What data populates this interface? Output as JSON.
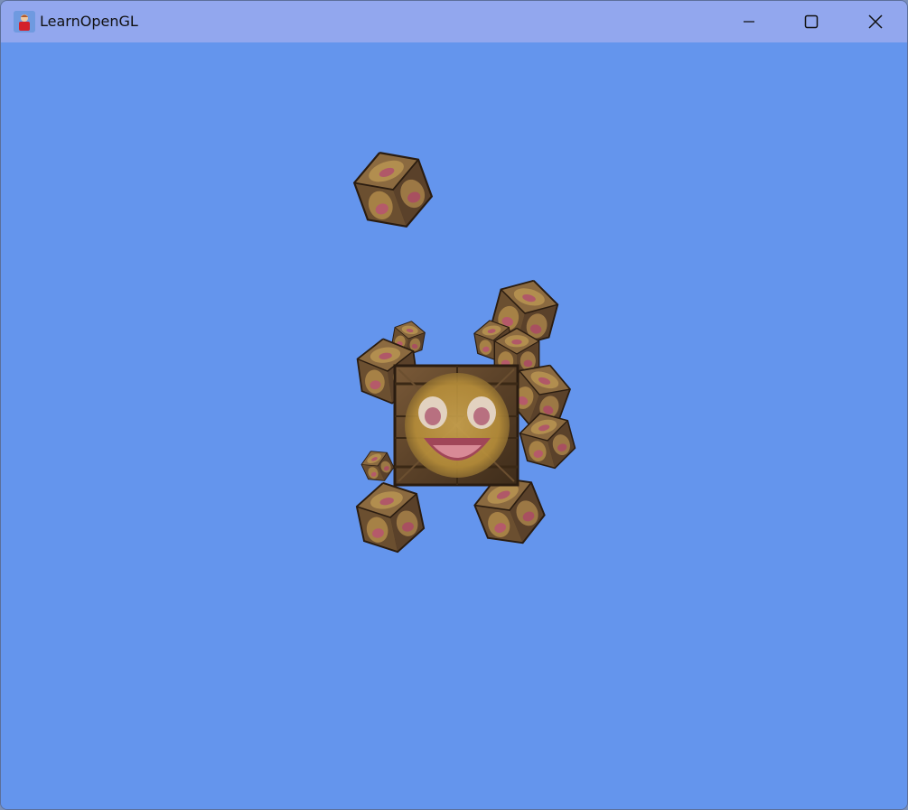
{
  "window": {
    "title": "LearnOpenGL",
    "app_icon": "app-icon",
    "controls": [
      "minimize-icon",
      "maximize-icon",
      "close-icon"
    ]
  },
  "viewport": {
    "clear_color": "#6495ed",
    "scene": "textured-cube-scene",
    "titlebar_color": "#92a7ee"
  }
}
